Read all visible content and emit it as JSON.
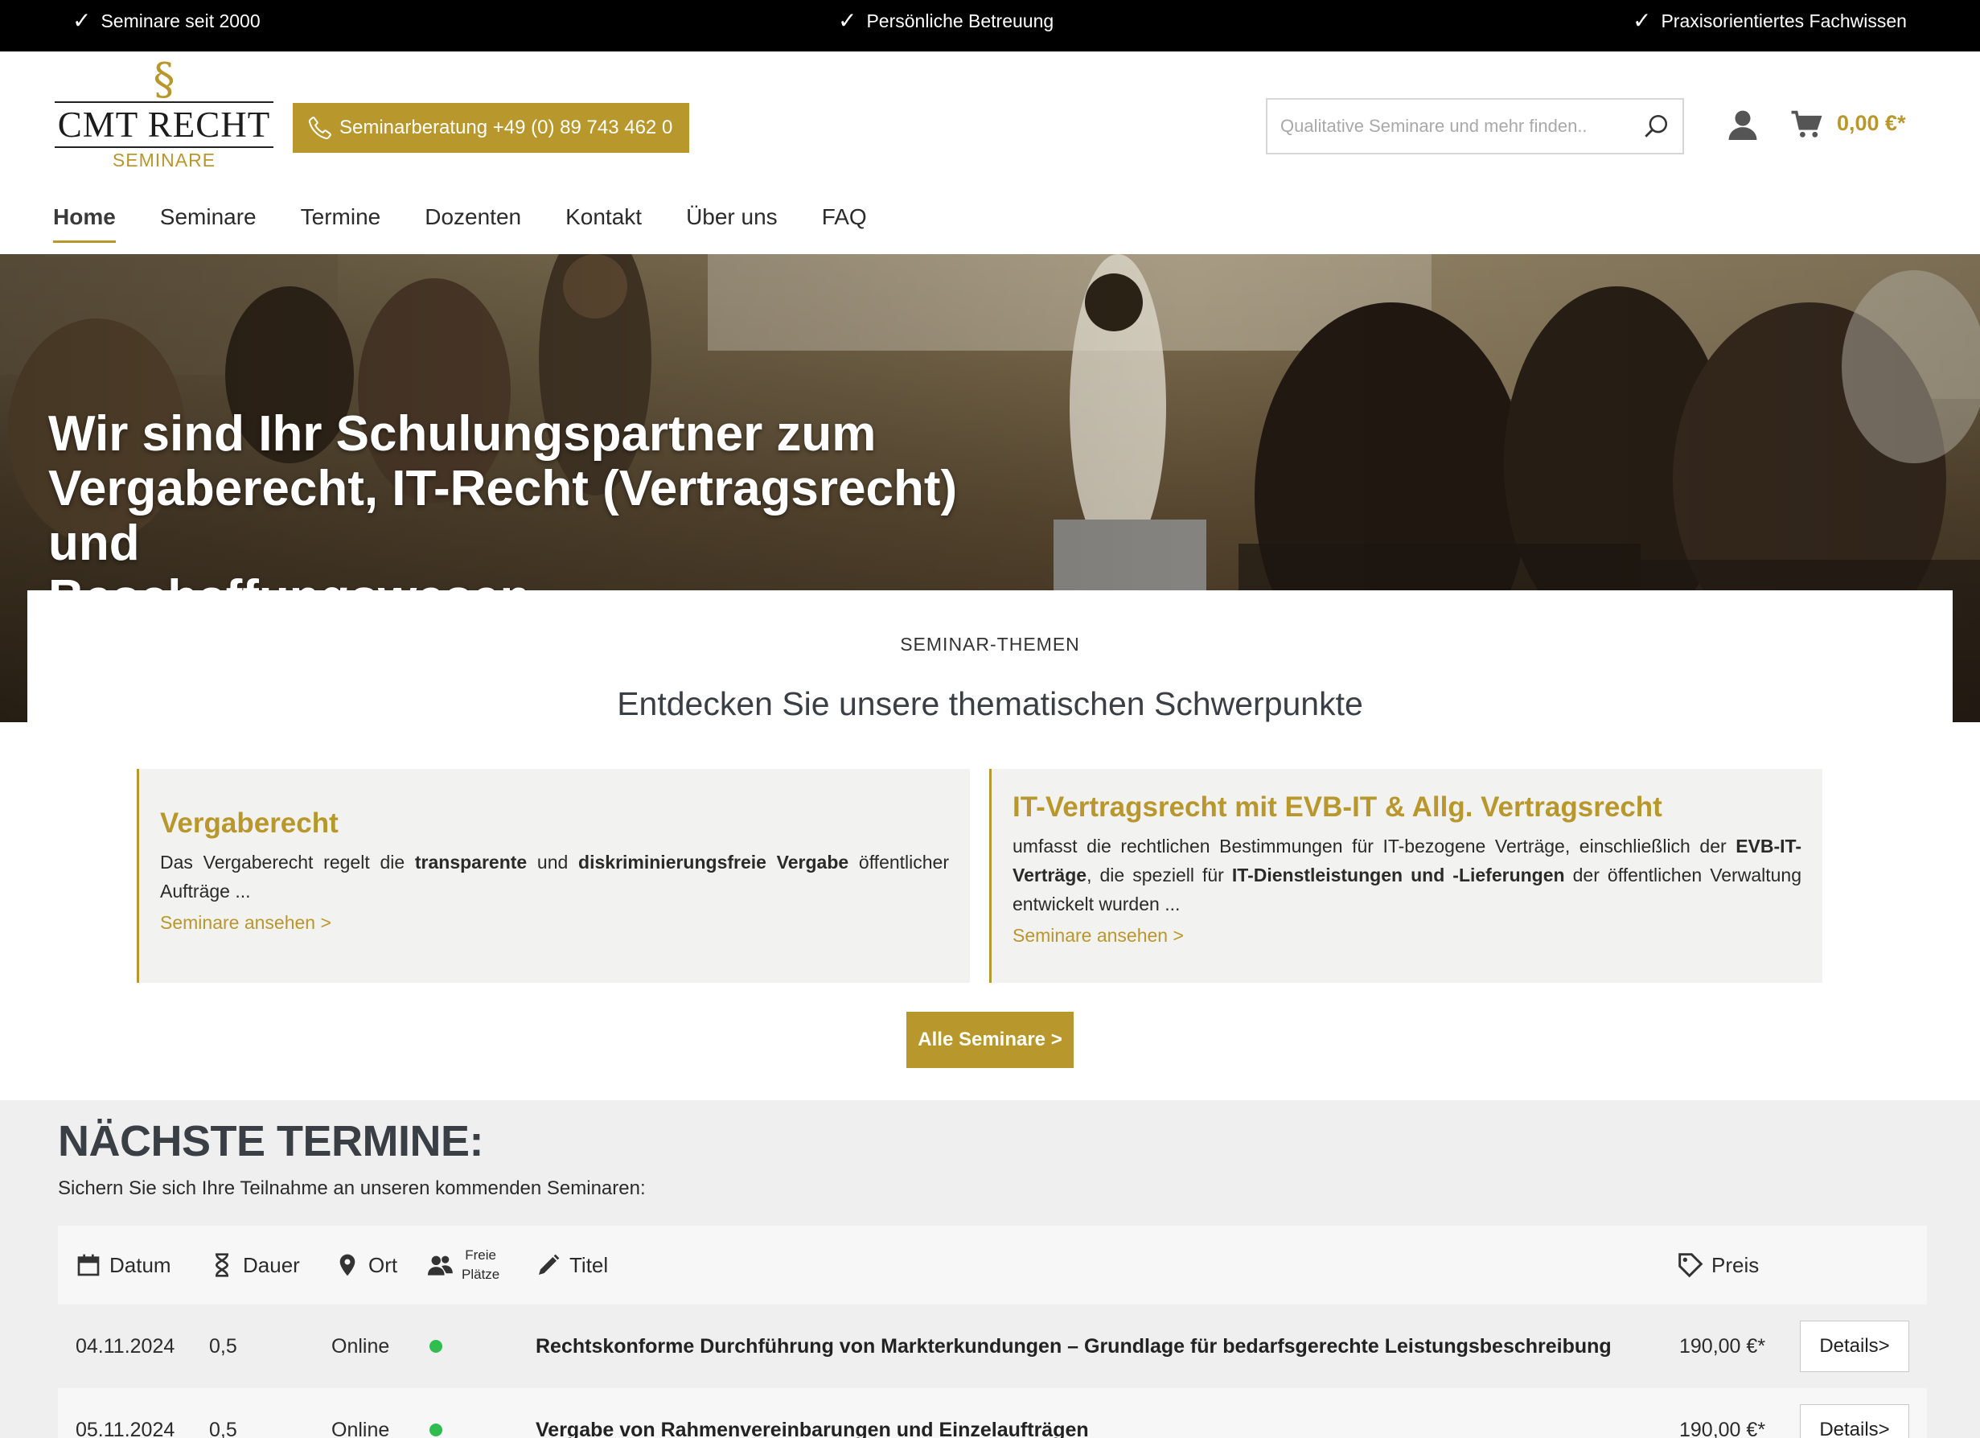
{
  "topbar": {
    "usps": [
      "Seminare seit 2000",
      "Persönliche Betreuung",
      "Praxisorientiertes Fachwissen"
    ]
  },
  "brand": {
    "symbol": "§",
    "name": "CMT RECHT",
    "tagline": "SEMINARE"
  },
  "header": {
    "phone_label": "Seminarberatung +49 (0) 89 743 462 0",
    "search_placeholder": "Qualitative Seminare und mehr finden..",
    "cart_total": "0,00 €*"
  },
  "nav": [
    "Home",
    "Seminare",
    "Termine",
    "Dozenten",
    "Kontakt",
    "Über uns",
    "FAQ"
  ],
  "hero": {
    "line1": "Wir sind Ihr Schulungspartner zum",
    "line2": "Vergaberecht, IT-Recht (Vertragsrecht) und",
    "line3": "Beschaffungswesen"
  },
  "themes": {
    "kicker": "SEMINAR-THEMEN",
    "headline": "Entdecken Sie unsere thematischen Schwerpunkte",
    "cards": [
      {
        "title": "Vergaberecht",
        "parts": [
          "Das Vergaberecht regelt die ",
          "transparente",
          " und ",
          "diskriminierungsfreie Vergabe",
          " öffentlicher Aufträge ..."
        ],
        "link": "Seminare ansehen >"
      },
      {
        "title": "IT-Vertragsrecht mit EVB-IT & Allg. Vertragsrecht",
        "parts": [
          "umfasst die rechtlichen Bestimmungen für IT-bezogene Verträge, einschließlich der ",
          "EVB-IT-Verträge",
          ", die speziell für ",
          "IT-Dienstleistungen und -Lieferungen",
          " der öffentlichen Verwaltung entwickelt wurden ..."
        ],
        "link": "Seminare ansehen >"
      }
    ],
    "all_button": "Alle Seminare >"
  },
  "dates": {
    "heading": "NÄCHSTE TERMINE:",
    "lead": "Sichern Sie sich Ihre Teilnahme an unseren kommenden Seminaren:",
    "columns": {
      "date": "Datum",
      "duration": "Dauer",
      "location": "Ort",
      "seats_line1": "Freie",
      "seats_line2": "Plätze",
      "title": "Titel",
      "price": "Preis"
    },
    "rows": [
      {
        "date": "04.11.2024",
        "duration": "0,5",
        "location": "Online",
        "title": "Rechtskonforme Durchführung von Markterkundungen – Grundlage für bedarfsgerechte Leistungsbeschreibung",
        "price": "190,00 €*",
        "button": "Details>"
      },
      {
        "date": "05.11.2024",
        "duration": "0,5",
        "location": "Online",
        "title": "Vergabe von Rahmenvereinbarungen und Einzelaufträgen",
        "price": "190,00 €*",
        "button": "Details>"
      }
    ]
  },
  "colors": {
    "gold": "#b8972c",
    "seat_available": "#2fbd4f",
    "topbar": "#000000"
  }
}
